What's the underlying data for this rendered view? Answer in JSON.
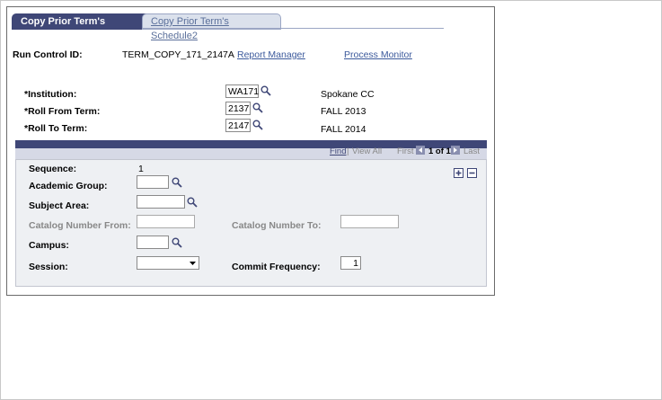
{
  "tabs": [
    {
      "label": "Copy Prior Term's Schedule",
      "active": true
    },
    {
      "label": "Copy Prior Term's Schedule2",
      "active": false
    }
  ],
  "run_control": {
    "label": "Run Control ID:",
    "value": "TERM_COPY_171_2147A"
  },
  "links": {
    "report_manager": "Report Manager",
    "process_monitor": "Process Monitor"
  },
  "fields": {
    "institution": {
      "label": "*Institution:",
      "value": "WA171",
      "description": "Spokane CC"
    },
    "roll_from": {
      "label": "*Roll From Term:",
      "value": "2137",
      "description": "FALL 2013"
    },
    "roll_to": {
      "label": "*Roll To Term:",
      "value": "2147",
      "description": "FALL 2014"
    }
  },
  "grid_nav": {
    "find": "Find",
    "sep1": "|",
    "view_all": "View All",
    "first": "First",
    "range": "1 of 1",
    "last": "Last"
  },
  "grid": {
    "sequence": {
      "label": "Sequence:",
      "value": "1"
    },
    "academic_group": {
      "label": "Academic Group:",
      "value": ""
    },
    "subject_area": {
      "label": "Subject Area:",
      "value": ""
    },
    "catalog_from": {
      "label": "Catalog Number From:",
      "value": ""
    },
    "catalog_to": {
      "label": "Catalog Number To:",
      "value": ""
    },
    "campus": {
      "label": "Campus:",
      "value": ""
    },
    "session": {
      "label": "Session:",
      "value": ""
    },
    "commit_frequency": {
      "label": "Commit Frequency:",
      "value": "1"
    },
    "plus": "+",
    "minus": "−"
  }
}
